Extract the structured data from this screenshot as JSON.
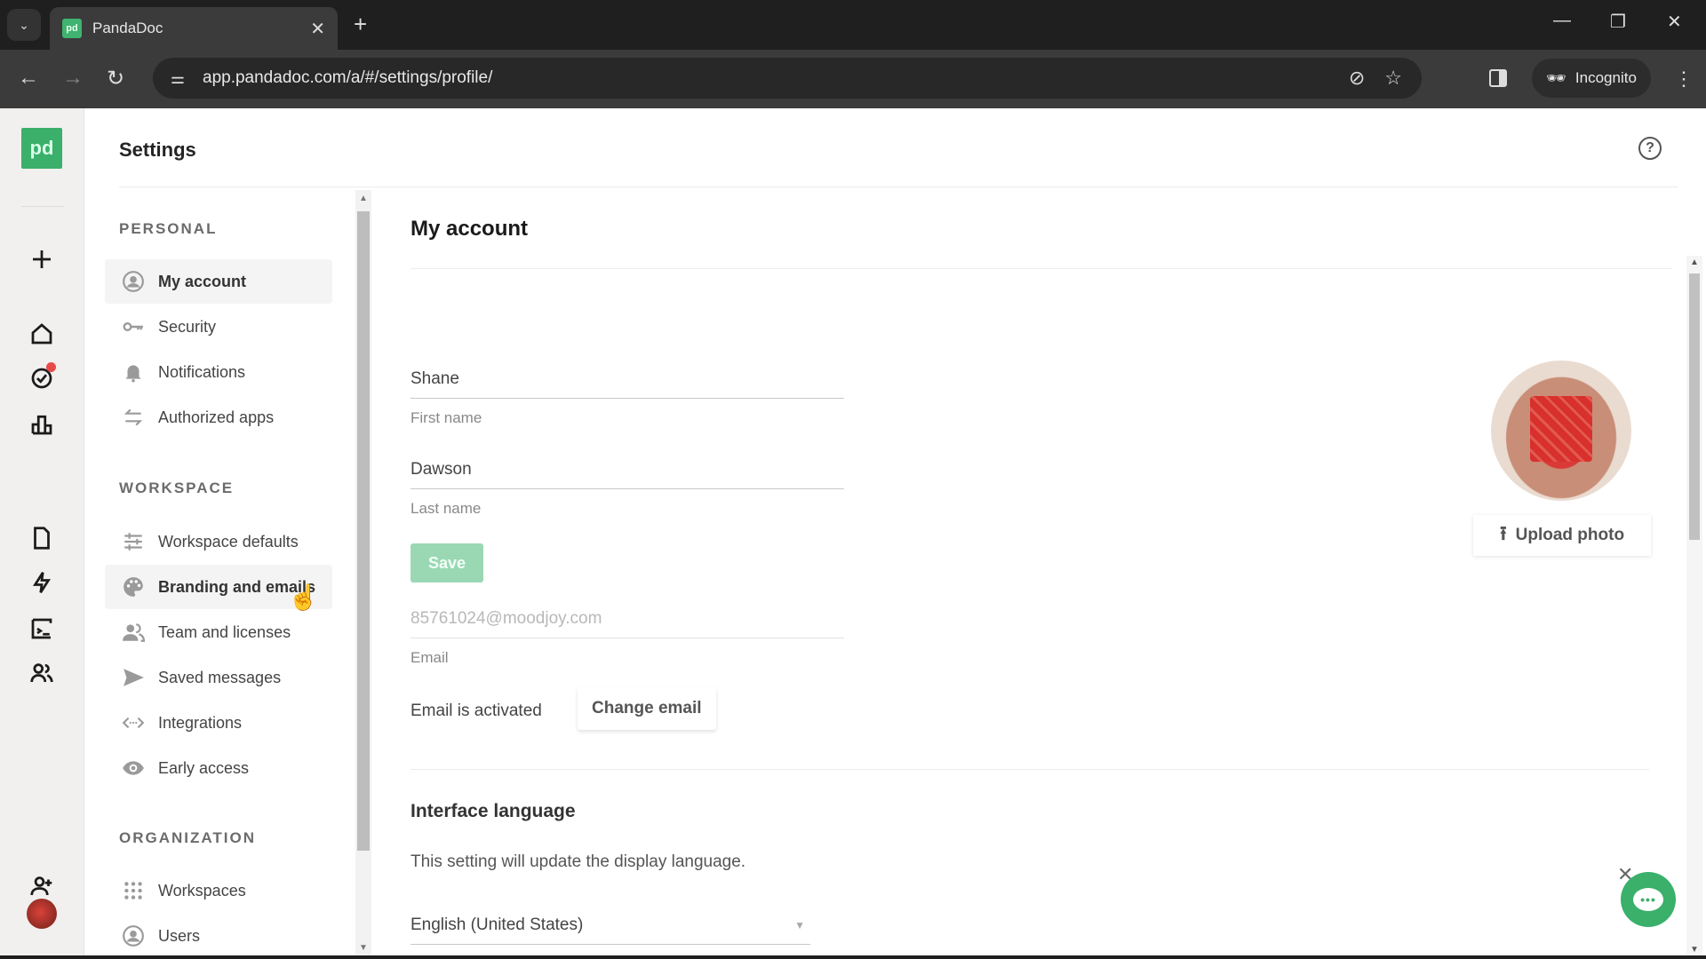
{
  "browser": {
    "tab_title": "PandaDoc",
    "favicon_text": "pd",
    "url": "app.pandadoc.com/a/#/settings/profile/",
    "incognito_label": "Incognito"
  },
  "app": {
    "logo_text": "pd",
    "rail_items": [
      "create",
      "home",
      "tasks",
      "reports",
      "documents",
      "automations",
      "templates",
      "contacts",
      "invite-user",
      "account"
    ],
    "header_title": "Settings"
  },
  "settings_nav": {
    "sections": [
      {
        "title": "PERSONAL",
        "items": [
          {
            "label": "My account",
            "icon": "user-circle-icon",
            "active": true
          },
          {
            "label": "Security",
            "icon": "key-icon"
          },
          {
            "label": "Notifications",
            "icon": "bell-icon"
          },
          {
            "label": "Authorized apps",
            "icon": "swap-arrows-icon"
          }
        ]
      },
      {
        "title": "WORKSPACE",
        "items": [
          {
            "label": "Workspace defaults",
            "icon": "sliders-icon"
          },
          {
            "label": "Branding and emails",
            "icon": "palette-icon",
            "hovered": true
          },
          {
            "label": "Team and licenses",
            "icon": "team-icon"
          },
          {
            "label": "Saved messages",
            "icon": "send-icon"
          },
          {
            "label": "Integrations",
            "icon": "code-icon"
          },
          {
            "label": "Early access",
            "icon": "eye-icon"
          }
        ]
      },
      {
        "title": "ORGANIZATION",
        "items": [
          {
            "label": "Workspaces",
            "icon": "grid-icon"
          },
          {
            "label": "Users",
            "icon": "user-circle-icon"
          }
        ]
      }
    ]
  },
  "account": {
    "title": "My account",
    "first_name": {
      "value": "Shane",
      "label": "First name"
    },
    "last_name": {
      "value": "Dawson",
      "label": "Last name"
    },
    "save_label": "Save",
    "email": {
      "value": "85761024@moodjoy.com",
      "label": "Email"
    },
    "email_status": "Email is activated",
    "change_email_label": "Change email",
    "upload_photo_label": "Upload photo"
  },
  "language": {
    "title": "Interface language",
    "description": "This setting will update the display language.",
    "selected": "English (United States)"
  },
  "colors": {
    "brand_green": "#3ab06b",
    "save_disabled": "#9ad8b4",
    "notification_dot": "#e84a4a"
  }
}
